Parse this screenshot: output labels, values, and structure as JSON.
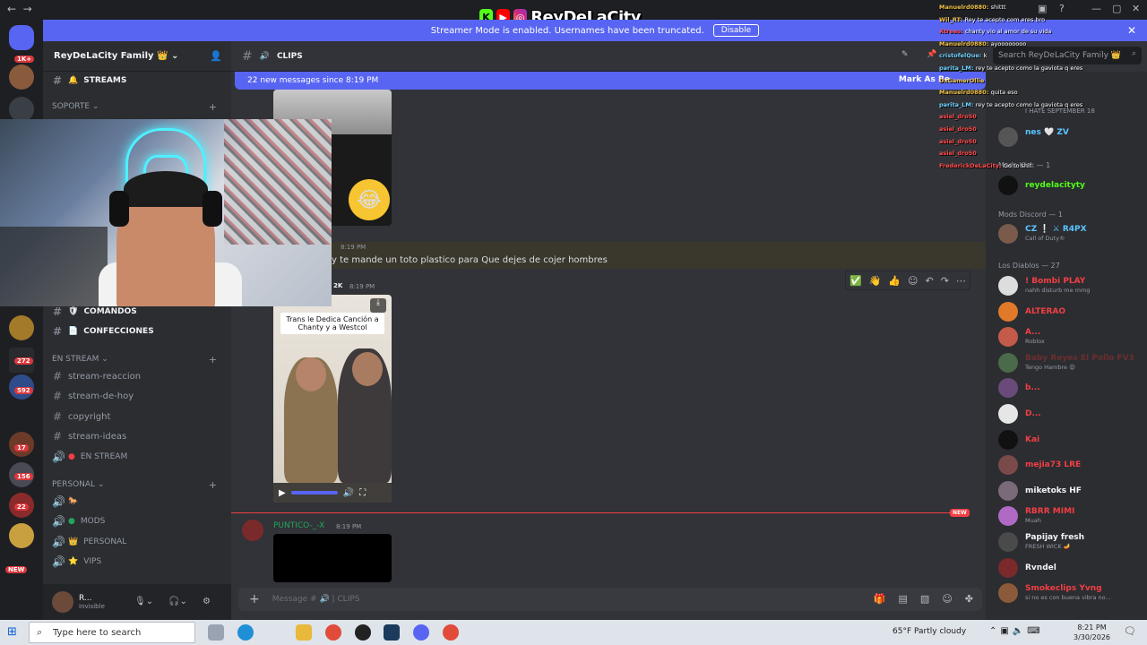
{
  "overlay": {
    "brand": "ReyDeLaCity",
    "k_label": "K"
  },
  "banner": {
    "text": "Streamer Mode is enabled. Usernames have been truncated.",
    "button": "Disable"
  },
  "rail": {
    "badges": [
      "1K+",
      "174",
      "272",
      "592",
      "17",
      "156",
      "22"
    ],
    "new_label": "NEW"
  },
  "sidebar": {
    "guild": "ReyDeLaCity Family 👑",
    "top_channel": "STREAMS",
    "cat_soporte": "SOPORTE",
    "comandos": "COMANDOS",
    "confecciones": "CONFECCIONES",
    "cat_en_stream": "EN STREAM",
    "channels": [
      "stream-reaccion",
      "stream-de-hoy",
      "copyright",
      "stream-ideas"
    ],
    "voice_en_stream": "EN STREAM",
    "cat_personal": "PERSONAL",
    "voice": [
      "MODS",
      "PERSONAL",
      "VIPS"
    ]
  },
  "user": {
    "name": "R...",
    "status": "Invisible"
  },
  "chat": {
    "channel": "CLIPS",
    "search_placeholder": "Search ReyDeLaCity Family 👑",
    "new_messages": "22 new messages since 8:19 PM",
    "mark_as_read": "Mark As Re",
    "msg1_time": "8:19 PM",
    "msg1_text": "y te mande un toto plastico para Que dejes de cojer hombres",
    "msg2_author": "2K",
    "msg2_time": "8:19 PM",
    "video_caption": "Trans le Dedica Canción a Chanty y a Westcol",
    "new_tag": "NEW",
    "msg3_author": "PUNTICO-_-X",
    "msg3_time": "8:19 PM",
    "composer_placeholder": "Message # 🔊 | CLIPS"
  },
  "members": {
    "top_user": "nes",
    "top_user_tag": "ZV",
    "top_user_status": "I HATE SEPTEMBER 18",
    "sec_mods_kick": "Mods Kick — 1",
    "mods_kick_user": "reydelacityty",
    "sec_mods_discord": "Mods Discord — 1",
    "mods_discord_tag": "R4PX",
    "mods_discord_status": "Call of Duty®",
    "sec_diablos": "Los Diablos — 27",
    "list": [
      {
        "name": "! Bombi",
        "tag": "PLAY",
        "status": "nahh disturb me mmg",
        "color": "#f23f43"
      },
      {
        "name": "ALTERAO",
        "tag": "",
        "status": "",
        "color": "#f23f43"
      },
      {
        "name": "A...",
        "tag": "",
        "status": "Roblox",
        "color": "#f23f43"
      },
      {
        "name": "Baby Reyes El Pollo",
        "tag": "FV3",
        "status": "Tengo Hambre 😫",
        "color": "#6b2f2f"
      },
      {
        "name": "b...",
        "tag": "",
        "status": "",
        "color": "#f23f43"
      },
      {
        "name": "D...",
        "tag": "",
        "status": "",
        "color": "#f23f43"
      },
      {
        "name": "Kai",
        "tag": "",
        "status": "",
        "color": "#f23f43"
      },
      {
        "name": "mejia73",
        "tag": "LRE",
        "status": "",
        "color": "#f23f43"
      },
      {
        "name": "miketoks",
        "tag": "HF",
        "status": "",
        "color": "#f2f3f5"
      },
      {
        "name": "RBRR",
        "tag": "MIMI",
        "status": "Muah",
        "color": "#f23f43"
      },
      {
        "name": "Papijay fresh",
        "tag": "",
        "status": "FRESH WICK 🪔",
        "color": "#f2f3f5"
      },
      {
        "name": "Rvndel",
        "tag": "",
        "status": "",
        "color": "#f2f3f5"
      },
      {
        "name": "Smokeclips",
        "tag": "Yvng",
        "status": "si no es con buena vibra no...",
        "color": "#f23f43"
      }
    ]
  },
  "stream_chat": [
    {
      "user": "Manuelrd0880",
      "msg": "shittt",
      "color": "#f0c24a"
    },
    {
      "user": "Wil_RT",
      "msg": "Rey te acepto com eres bro",
      "color": "#f0c24a"
    },
    {
      "user": "Xtrees",
      "msg": "chanty vio al amor de su vida",
      "color": "#ff4b4b"
    },
    {
      "user": "Manuelrd0880",
      "msg": "ayoooooooo",
      "color": "#f0c24a"
    },
    {
      "user": "cristofelQue",
      "msg": "k",
      "color": "#6fd3ff"
    },
    {
      "user": "parita_LM",
      "msg": "rey te acepto como la gaviota q eres",
      "color": "#6fd3ff"
    },
    {
      "user": "DxGamerOllie",
      "msg": "",
      "color": "#f0c24a"
    },
    {
      "user": "Manuelrd0880",
      "msg": "quita eso",
      "color": "#f0c24a"
    },
    {
      "user": "parita_LM",
      "msg": "rey te acepto como la gaviota q eres",
      "color": "#6fd3ff"
    },
    {
      "user": "asiel_dro50",
      "msg": "",
      "color": "#ff4b4b"
    },
    {
      "user": "asiel_dro50",
      "msg": "",
      "color": "#ff4b4b"
    },
    {
      "user": "asiel_dro50",
      "msg": "",
      "color": "#ff4b4b"
    },
    {
      "user": "asiel_dro50",
      "msg": "",
      "color": "#ff4b4b"
    },
    {
      "user": "FrederickDeLaCity",
      "msg": "Go to shit",
      "color": "#ff4b4b"
    }
  ],
  "taskbar": {
    "search_placeholder": "Type here to search",
    "weather": "65°F  Partly cloudy",
    "time": "8:21 PM",
    "date": "3/30/2026"
  }
}
